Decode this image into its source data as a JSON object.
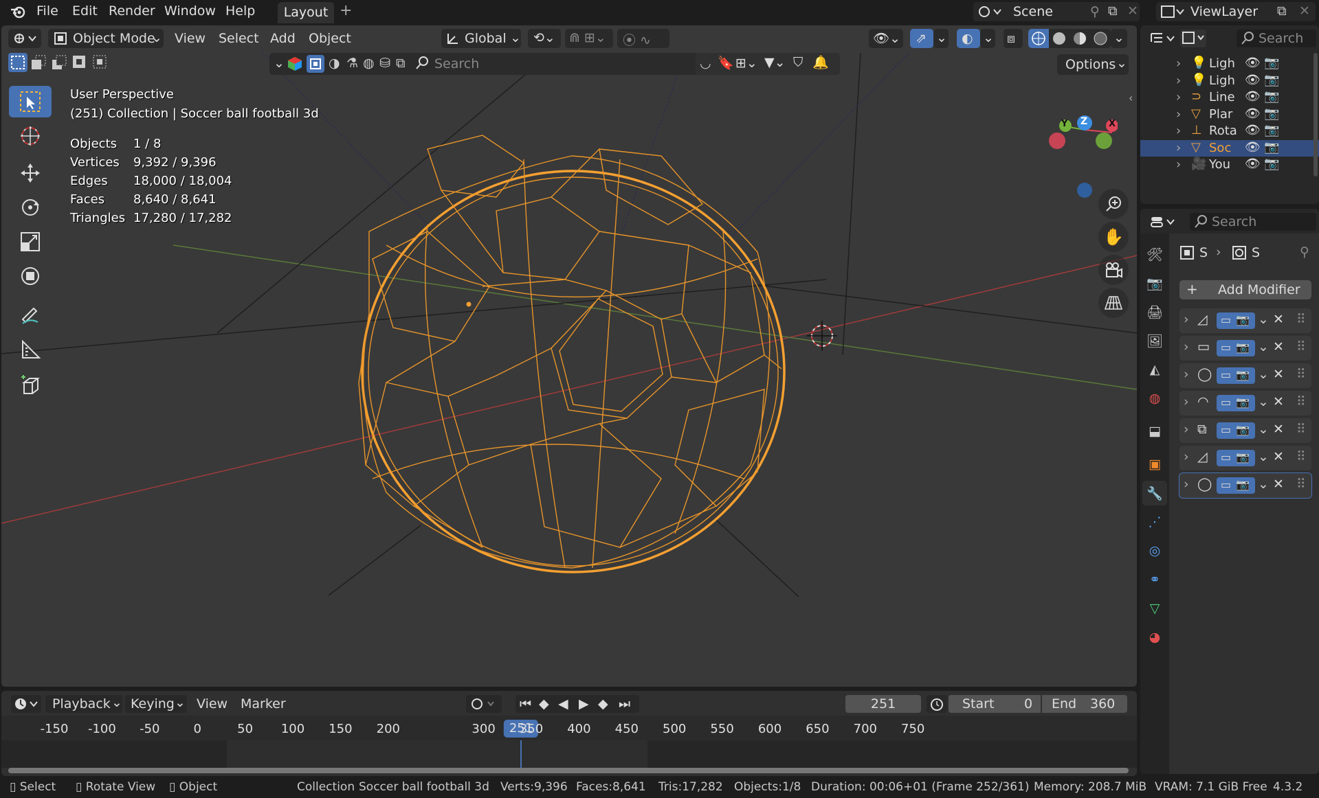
{
  "topbar": {
    "menus": [
      "File",
      "Edit",
      "Render",
      "Window",
      "Help"
    ],
    "workspace_tab": "Layout",
    "add_tab": "+",
    "scene": "Scene",
    "view_layer": "ViewLayer"
  },
  "viewport_header": {
    "mode": "Object Mode",
    "menus": [
      "View",
      "Select",
      "Add",
      "Object"
    ],
    "transform_orientation": "Global",
    "search_placeholder": "Search",
    "options_label": "Options"
  },
  "viewport_overlay": {
    "perspective": "User Perspective",
    "collection_line": "(251) Collection | Soccer ball football 3d",
    "stats": [
      {
        "label": "Objects",
        "value": "1 / 8"
      },
      {
        "label": "Vertices",
        "value": "9,392 / 9,396"
      },
      {
        "label": "Edges",
        "value": "18,000 / 18,004"
      },
      {
        "label": "Faces",
        "value": "8,640 / 8,641"
      },
      {
        "label": "Triangles",
        "value": "17,280 / 17,282"
      }
    ],
    "gizmo": {
      "z": "Z",
      "y": "Y",
      "x": "X"
    }
  },
  "outliner": {
    "search_placeholder": "Search",
    "items": [
      {
        "label": "Ligh",
        "icon": "light-icon",
        "selected": false
      },
      {
        "label": "Ligh",
        "icon": "light-icon",
        "selected": false
      },
      {
        "label": "Line",
        "icon": "curve-icon",
        "selected": false
      },
      {
        "label": "Plar",
        "icon": "mesh-icon",
        "selected": false
      },
      {
        "label": "Rota",
        "icon": "empty-icon",
        "selected": false
      },
      {
        "label": "Soc",
        "icon": "mesh-icon",
        "selected": true
      },
      {
        "label": "You",
        "icon": "camera-icon",
        "selected": false
      }
    ]
  },
  "properties": {
    "search_placeholder": "Search",
    "breadcrumb_object": "S",
    "breadcrumb_data": "S",
    "add_modifier": "Add Modifier",
    "modifiers": [
      {
        "icon": "mod-subsurf-icon"
      },
      {
        "icon": "mod-solidify-icon"
      },
      {
        "icon": "mod-cast-icon"
      },
      {
        "icon": "mod-bevel-icon"
      },
      {
        "icon": "mod-array-icon"
      },
      {
        "icon": "mod-subsurf-icon"
      },
      {
        "icon": "mod-cast-icon"
      }
    ]
  },
  "timeline": {
    "menus": [
      "Playback",
      "Keying",
      "View",
      "Marker"
    ],
    "current_frame": "251",
    "start_label": "Start",
    "start_value": "0",
    "end_label": "End",
    "end_value": "360",
    "ticks": [
      "-150",
      "-100",
      "-50",
      "0",
      "50",
      "100",
      "150",
      "200",
      "251",
      "300",
      "350",
      "400",
      "450",
      "500",
      "550",
      "600",
      "650",
      "700",
      "750"
    ]
  },
  "statusbar": {
    "hints": [
      "Select",
      "Rotate View",
      "Object"
    ],
    "collection": "Collection",
    "object": "Soccer ball football 3d",
    "verts": "Verts:9,396",
    "faces": "Faces:8,641",
    "tris": "Tris:17,282",
    "objects": "Objects:1/8",
    "duration": "Duration: 00:06+01 (Frame 252/361)",
    "memory": "Memory: 208.7 MiB",
    "vram": "VRAM: 7.1 GiB Free",
    "version": "4.3.2"
  },
  "colors": {
    "accent": "#4772b3",
    "selection_orange": "#f5a031",
    "viewport_bg": "#393939"
  }
}
